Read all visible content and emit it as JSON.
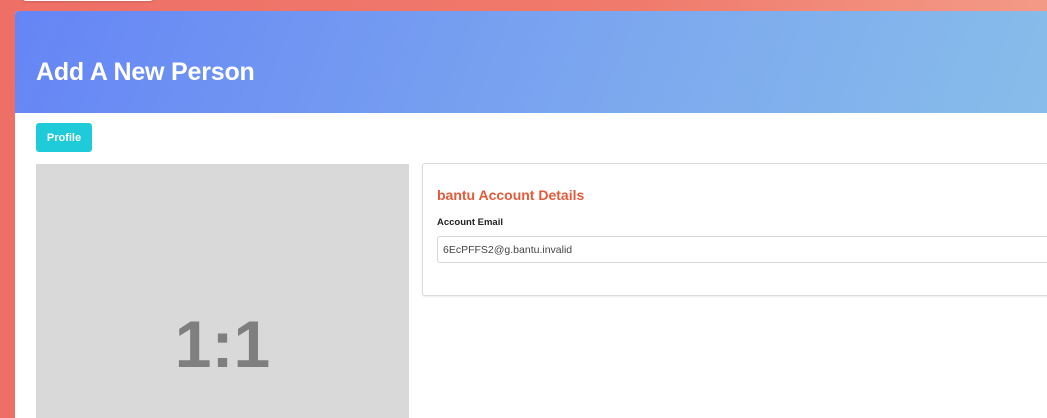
{
  "header": {
    "title": "Add A New Person"
  },
  "toolbar": {
    "profile_label": "Profile"
  },
  "image": {
    "placeholder_text": "1:1"
  },
  "account_card": {
    "title": "bantu Account Details",
    "email_label": "Account Email",
    "email_value": "6EcPFFS2@g.bantu.invalid"
  },
  "colors": {
    "background": "#ee6f66",
    "header_gradient_start": "#6585f5",
    "header_gradient_end": "#88bdea",
    "profile_button": "#1fcad9",
    "card_title": "#e45a3a",
    "placeholder_bg": "#d9d9d9"
  }
}
